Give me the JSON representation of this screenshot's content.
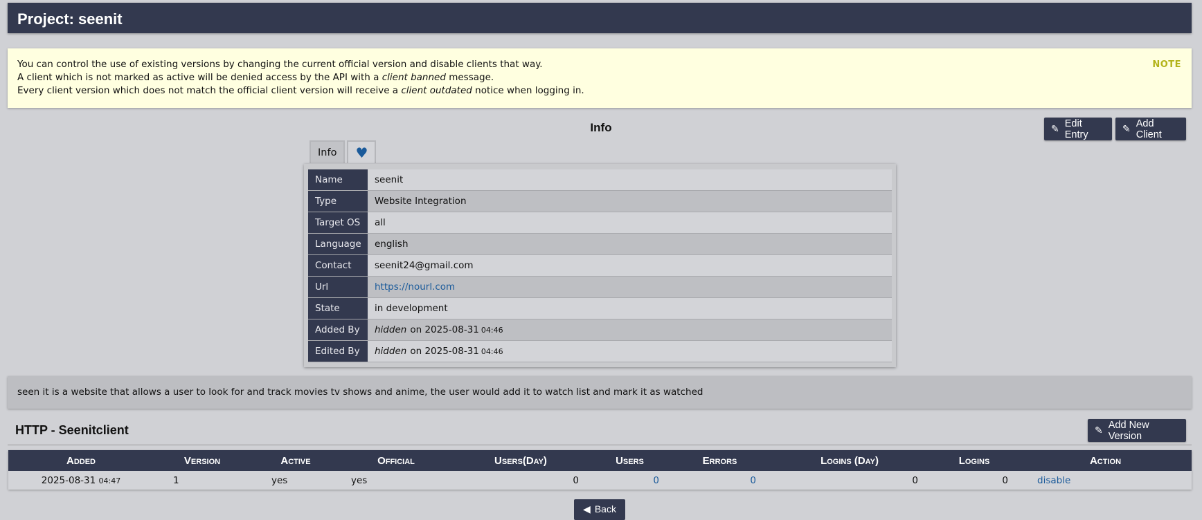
{
  "page": {
    "title": "Project: seenit"
  },
  "note": {
    "tag": "NOTE",
    "line1": "You can control the use of existing versions by changing the current official version and disable clients that way.",
    "line2_pre": "A client which is not marked as active will be denied access by the API with a ",
    "line2_em": "client banned",
    "line2_post": " message.",
    "line3_pre": "Every client version which does not match the official client version will receive a ",
    "line3_em": "client outdated",
    "line3_post": " notice when logging in."
  },
  "info_section": {
    "title": "Info",
    "edit_button": "Edit Entry",
    "add_client_button": "Add Client",
    "tabs": {
      "info": "Info"
    },
    "rows": {
      "name": {
        "label": "Name",
        "value": "seenit"
      },
      "type": {
        "label": "Type",
        "value": "Website Integration"
      },
      "target_os": {
        "label": "Target OS",
        "value": "all"
      },
      "language": {
        "label": "Language",
        "value": "english"
      },
      "contact": {
        "label": "Contact",
        "value": "seenit24@gmail.com"
      },
      "url": {
        "label": "Url",
        "value": "https://nourl.com"
      },
      "state": {
        "label": "State",
        "value": "in development"
      },
      "added_by": {
        "label": "Added By",
        "user": "hidden",
        "on": "on",
        "date": "2025-08-31",
        "time": "04:46"
      },
      "edited_by": {
        "label": "Edited By",
        "user": "hidden",
        "on": "on",
        "date": "2025-08-31",
        "time": "04:46"
      }
    }
  },
  "description": "seen it is a website that allows a user to look for and track movies tv shows and anime, the user would add it to watch list and mark it as watched",
  "client_section": {
    "title": "HTTP - Seenitclient",
    "add_version_button": "Add New Version",
    "columns": [
      "Added",
      "Version",
      "Active",
      "Official",
      "Users(Day)",
      "Users",
      "Errors",
      "Logins (Day)",
      "Logins",
      "Action"
    ],
    "rows": [
      {
        "added_date": "2025-08-31",
        "added_time": "04:47",
        "version": "1",
        "active": "yes",
        "official": "yes",
        "users_day": "0",
        "users": "0",
        "errors": "0",
        "logins_day": "0",
        "logins": "0",
        "action": "disable"
      }
    ]
  },
  "back_button": "Back",
  "colors": {
    "header": "#33394f",
    "note_bg": "#ffffe0",
    "link": "#1a5a9a",
    "note_tag": "#b3b31a"
  }
}
